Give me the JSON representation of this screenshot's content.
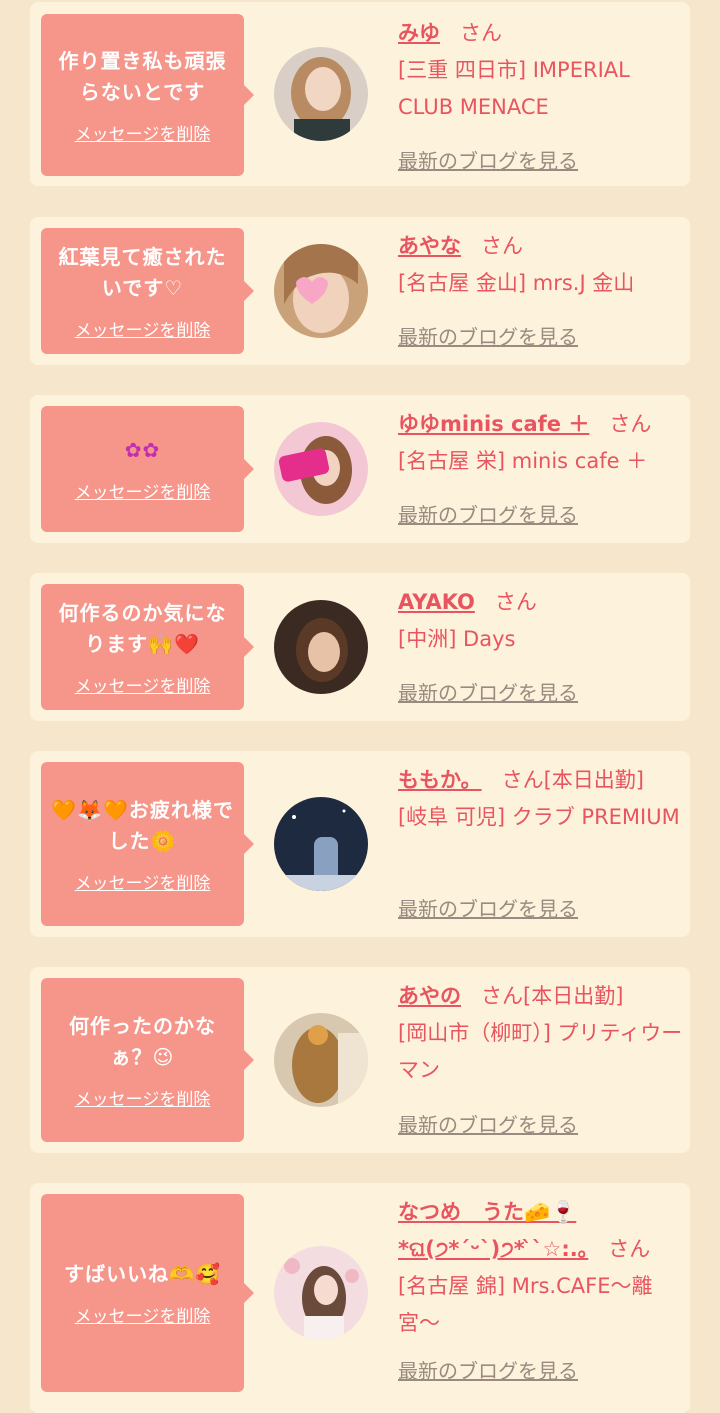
{
  "colors": {
    "page_bg": "#f5e6cc",
    "card_bg": "#fdf3dc",
    "bubble": "#f6958a",
    "name": "#e8545f",
    "blog_link": "#9a8a80"
  },
  "items": [
    {
      "message": "作り置き私も頑張らないとです",
      "delete_label": "メッセージを削除",
      "name": "みゆ",
      "san": "さん",
      "status": "",
      "shop": "[三重 四日市] IMPERIAL CLUB MENACE",
      "blog_label": "最新のブログを見る"
    },
    {
      "message": "紅葉見て癒されたいです♡",
      "delete_label": "メッセージを削除",
      "name": "あやな",
      "san": "さん",
      "status": "",
      "shop": "[名古屋 金山] mrs.J 金山",
      "blog_label": "最新のブログを見る"
    },
    {
      "message": "✿✿",
      "delete_label": "メッセージを削除",
      "name": "ゆゆminis cafe ＋",
      "san": "さん",
      "status": "",
      "shop": "[名古屋 栄] minis cafe ＋",
      "blog_label": "最新のブログを見る"
    },
    {
      "message": "何作るのか気になります🙌❤️",
      "delete_label": "メッセージを削除",
      "name": "AYAKO",
      "san": "さん",
      "status": "",
      "shop": "[中洲] Days",
      "blog_label": "最新のブログを見る"
    },
    {
      "message": "🧡🦊🧡お疲れ様でした🌼",
      "delete_label": "メッセージを削除",
      "name": "ももか。",
      "san": "さん",
      "status": "[本日出勤]",
      "shop": "[岐阜 可児] クラブ PREMIUM",
      "blog_label": "最新のブログを見る"
    },
    {
      "message": "何作ったのかなぁ？😉",
      "delete_label": "メッセージを削除",
      "name": "あやの",
      "san": "さん",
      "status": "[本日出勤]",
      "shop": "[岡山市（柳町）] プリティウーマン",
      "blog_label": "最新のブログを見る"
    },
    {
      "message": "すばいいね🫶🥰",
      "delete_label": "メッセージを削除",
      "name": "なつめ　うた🧀🍷*ଘ(੭*ˊᵕˋ)੭* ̀ˋ☆:.｡",
      "san": "さん",
      "status": "",
      "shop": "[名古屋 錦] Mrs.CAFE〜離宮〜",
      "blog_label": "最新のブログを見る"
    }
  ]
}
